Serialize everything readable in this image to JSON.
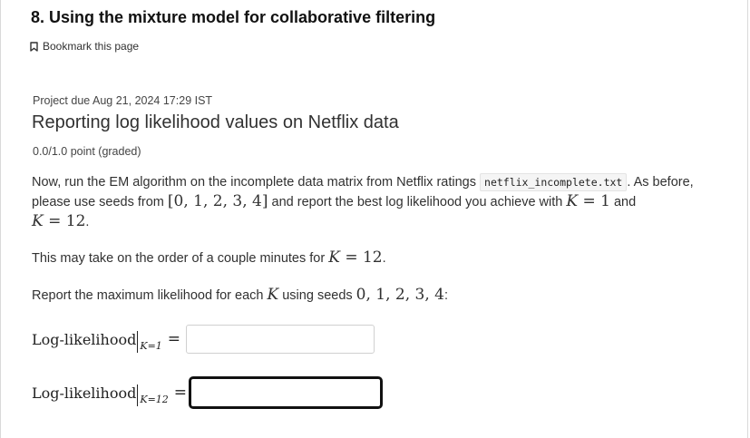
{
  "section_title": "8. Using the mixture model for collaborative filtering",
  "bookmark_label": "Bookmark this page",
  "due_text": "Project due Aug 21, 2024 17:29 IST",
  "problem_title": "Reporting log likelihood values on Netflix data",
  "points_text": "0.0/1.0 point (graded)",
  "paragraph1": {
    "text_a": "Now, run the EM algorithm on the incomplete data matrix from Netflix ratings ",
    "code": "netflix_incomplete.txt",
    "text_b": ". As before, please use seeds from ",
    "seeds_bracket": "[0, 1, 2, 3, 4]",
    "text_c": " and report the best log likelihood you achieve with ",
    "k_var": "K",
    "k1_val": " = 1",
    "text_d": " and ",
    "k12_val": " = 12",
    "text_e": "."
  },
  "paragraph2": {
    "text_a": "This may take on the order of a couple minutes for ",
    "k_var": "K",
    "k_val": " = 12",
    "text_b": "."
  },
  "paragraph3": {
    "text_a": "Report the maximum likelihood for each ",
    "k_var": "K",
    "text_b": " using seeds ",
    "seeds": "0, 1, 2, 3, 4",
    "text_c": ":"
  },
  "answers": [
    {
      "label": "Log-likelihood",
      "subscript": "K=1",
      "equals": "=",
      "value": ""
    },
    {
      "label": "Log-likelihood",
      "subscript": "K=12",
      "equals": "=",
      "value": ""
    }
  ]
}
